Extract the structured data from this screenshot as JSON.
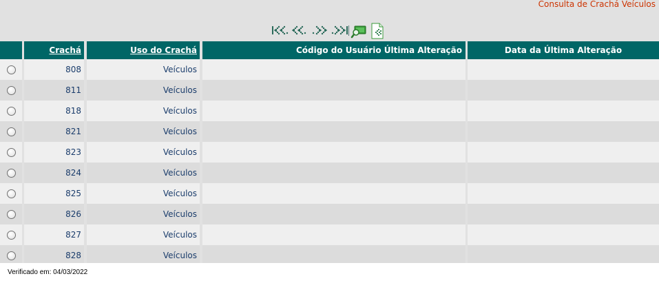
{
  "page": {
    "title": "Consulta de Crachá Veículos"
  },
  "toolbar": {
    "icons": [
      "first-page-icon",
      "previous-page-icon",
      "next-page-icon",
      "last-page-icon",
      "search-icon",
      "export-excel-icon"
    ]
  },
  "table": {
    "headers": {
      "cracha": "Crachá",
      "uso": "Uso do Crachá",
      "codigo_usuario": "Código do Usuário Última Alteração",
      "data_alteracao": "Data da Última Alteração"
    },
    "rows": [
      {
        "cracha": "808",
        "uso": "Veículos",
        "codigo_usuario": "",
        "data_alteracao": ""
      },
      {
        "cracha": "811",
        "uso": "Veículos",
        "codigo_usuario": "",
        "data_alteracao": ""
      },
      {
        "cracha": "818",
        "uso": "Veículos",
        "codigo_usuario": "",
        "data_alteracao": ""
      },
      {
        "cracha": "821",
        "uso": "Veículos",
        "codigo_usuario": "",
        "data_alteracao": ""
      },
      {
        "cracha": "823",
        "uso": "Veículos",
        "codigo_usuario": "",
        "data_alteracao": ""
      },
      {
        "cracha": "824",
        "uso": "Veículos",
        "codigo_usuario": "",
        "data_alteracao": ""
      },
      {
        "cracha": "825",
        "uso": "Veículos",
        "codigo_usuario": "",
        "data_alteracao": ""
      },
      {
        "cracha": "826",
        "uso": "Veículos",
        "codigo_usuario": "",
        "data_alteracao": ""
      },
      {
        "cracha": "827",
        "uso": "Veículos",
        "codigo_usuario": "",
        "data_alteracao": ""
      },
      {
        "cracha": "828",
        "uso": "Veículos",
        "codigo_usuario": "",
        "data_alteracao": ""
      }
    ]
  },
  "footer": {
    "verified_text": "Verificado em: 04/03/2022"
  },
  "colors": {
    "header_bg": "#006666",
    "title_red": "#cc3300",
    "cell_text": "#1a3c6b",
    "row_light": "#efefef",
    "row_dark": "#dcdcdc"
  }
}
